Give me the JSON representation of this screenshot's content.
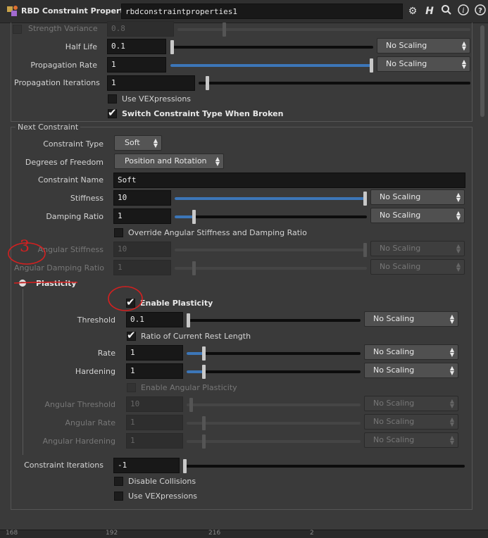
{
  "header": {
    "node_type": "RBD Constraint Properties",
    "node_name": "rbdconstraintproperties1",
    "icons": [
      "gear-icon",
      "help-h-icon",
      "search-icon",
      "info-icon",
      "question-icon"
    ]
  },
  "params_top": {
    "strength_variance": {
      "label": "Strength Variance",
      "value": "0.8"
    },
    "half_life": {
      "label": "Half Life",
      "value": "0.1",
      "scaling": "No Scaling"
    },
    "propagation_rate": {
      "label": "Propagation Rate",
      "value": "1",
      "scaling": "No Scaling"
    },
    "propagation_iterations": {
      "label": "Propagation Iterations",
      "value": "1"
    },
    "use_vexpressions": {
      "label": "Use VEXpressions",
      "checked": false
    },
    "switch_type": {
      "label": "Switch Constraint Type When Broken",
      "checked": true
    }
  },
  "next_constraint": {
    "title": "Next Constraint",
    "constraint_type": {
      "label": "Constraint Type",
      "value": "Soft"
    },
    "dof": {
      "label": "Degrees of Freedom",
      "value": "Position and Rotation"
    },
    "constraint_name": {
      "label": "Constraint Name",
      "value": "Soft"
    },
    "stiffness": {
      "label": "Stiffness",
      "value": "10",
      "scaling": "No Scaling"
    },
    "damping": {
      "label": "Damping Ratio",
      "value": "1",
      "scaling": "No Scaling"
    },
    "override": {
      "label": "Override Angular Stiffness and Damping Ratio",
      "checked": false
    },
    "ang_stiffness": {
      "label": "Angular Stiffness",
      "value": "10",
      "scaling": "No Scaling"
    },
    "ang_damping": {
      "label": "Angular Damping Ratio",
      "value": "1",
      "scaling": "No Scaling"
    }
  },
  "plasticity": {
    "title": "Plasticity",
    "enable": {
      "label": "Enable Plasticity",
      "checked": true
    },
    "threshold": {
      "label": "Threshold",
      "value": "0.1",
      "scaling": "No Scaling"
    },
    "ratio": {
      "label": "Ratio of Current Rest Length",
      "checked": true
    },
    "rate": {
      "label": "Rate",
      "value": "1",
      "scaling": "No Scaling"
    },
    "hardening": {
      "label": "Hardening",
      "value": "1",
      "scaling": "No Scaling"
    },
    "enable_angular": {
      "label": "Enable Angular Plasticity",
      "checked": false
    },
    "ang_threshold": {
      "label": "Angular Threshold",
      "value": "10",
      "scaling": "No Scaling"
    },
    "ang_rate": {
      "label": "Angular Rate",
      "value": "1",
      "scaling": "No Scaling"
    },
    "ang_hardening": {
      "label": "Angular Hardening",
      "value": "1",
      "scaling": "No Scaling"
    }
  },
  "bottom": {
    "iterations": {
      "label": "Constraint Iterations",
      "value": "-1"
    },
    "disable_collisions": {
      "label": "Disable Collisions",
      "checked": false
    },
    "use_vex": {
      "label": "Use VEXpressions",
      "checked": false
    }
  },
  "annotations": {
    "circle_note": "3"
  },
  "ruler": [
    "168",
    "192",
    "216",
    "2"
  ],
  "colors": {
    "accent": "#3c76b8",
    "annotation": "#d42020",
    "background": "#3a3a3a"
  }
}
